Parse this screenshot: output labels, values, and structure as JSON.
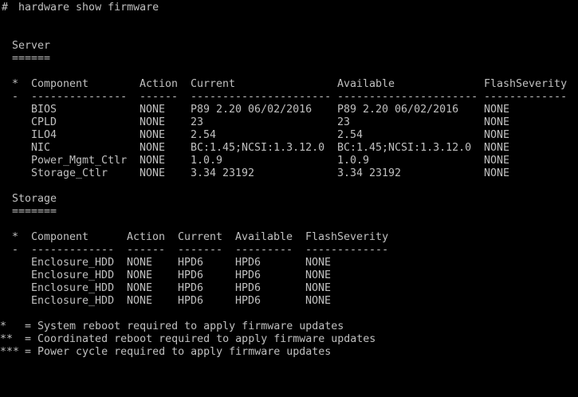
{
  "prompt": {
    "symbol": "#",
    "command": "hardware show firmware"
  },
  "server": {
    "title": "Server",
    "underline": "======",
    "headers": [
      "*",
      "Component",
      "Action",
      "Current",
      "Available",
      "FlashSeverity"
    ],
    "dashes": [
      "-",
      "---------------",
      "------",
      "----------------------",
      "----------------------",
      "-------------"
    ],
    "rows": [
      [
        "BIOS",
        "NONE",
        "P89 2.20 06/02/2016",
        "P89 2.20 06/02/2016",
        "NONE"
      ],
      [
        "CPLD",
        "NONE",
        "23",
        "23",
        "NONE"
      ],
      [
        "ILO4",
        "NONE",
        "2.54",
        "2.54",
        "NONE"
      ],
      [
        "NIC",
        "NONE",
        "BC:1.45;NCSI:1.3.12.0",
        "BC:1.45;NCSI:1.3.12.0",
        "NONE"
      ],
      [
        "Power_Mgmt_Ctlr",
        "NONE",
        "1.0.9",
        "1.0.9",
        "NONE"
      ],
      [
        "Storage_Ctlr",
        "NONE",
        "3.34 23192",
        "3.34 23192",
        "NONE"
      ]
    ]
  },
  "storage": {
    "title": "Storage",
    "underline": "=======",
    "headers": [
      "*",
      "Component",
      "Action",
      "Current",
      "Available",
      "FlashSeverity"
    ],
    "dashes": [
      "-",
      "-------------",
      "------",
      "-------",
      "---------",
      "-------------"
    ],
    "rows": [
      [
        "Enclosure_HDD",
        "NONE",
        "HPD6",
        "HPD6",
        "NONE"
      ],
      [
        "Enclosure_HDD",
        "NONE",
        "HPD6",
        "HPD6",
        "NONE"
      ],
      [
        "Enclosure_HDD",
        "NONE",
        "HPD6",
        "HPD6",
        "NONE"
      ],
      [
        "Enclosure_HDD",
        "NONE",
        "HPD6",
        "HPD6",
        "NONE"
      ]
    ]
  },
  "legend": [
    {
      "marker": "*",
      "text": "= System reboot required to apply firmware updates"
    },
    {
      "marker": "**",
      "text": "= Coordinated reboot required to apply firmware updates"
    },
    {
      "marker": "***",
      "text": "= Power cycle required to apply firmware updates"
    }
  ],
  "colors": {
    "background": "#000000",
    "text": "#c0c0c0"
  }
}
